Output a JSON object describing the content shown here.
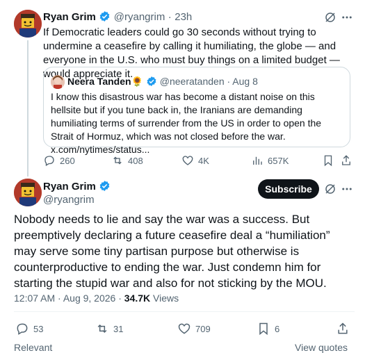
{
  "tweet1": {
    "author_name": "Ryan Grim",
    "handle": "@ryangrim",
    "time": "23h",
    "text": "If Democratic leaders could go 30 seconds without trying to undermine a ceasefire by calling it humiliating, the globe — and everyone in the U.S. who must buy things on a limited budget — would appreciate it.",
    "quote": {
      "author_name": "Neera Tanden",
      "emoji": "🌻",
      "handle": "@neeratanden",
      "date": "Aug 8",
      "text": "I know this disastrous war has become a distant noise on this hellsite but if you tune back in, the Iranians are demanding humiliating terms of surrender from the US in order to open the Strait of Hormuz, which was not closed before the war. x.com/nytimes/status..."
    },
    "stats": {
      "replies": "260",
      "reposts": "408",
      "likes": "4K",
      "views": "657K"
    }
  },
  "tweet2": {
    "author_name": "Ryan Grim",
    "handle": "@ryangrim",
    "subscribe_label": "Subscribe",
    "text": "Nobody needs to lie and say the war was a success. But preemptively declaring a future ceasefire deal a “humiliation” may serve some tiny partisan purpose but otherwise is counterproductive to ending the war. Just condemn him for starting the stupid war and also for not sticking by the MOU.",
    "timestamp": "12:07 AM · Aug 9, 2026 · ",
    "views_count": "34.7K",
    "views_label": " Views",
    "stats": {
      "replies": "53",
      "reposts": "31",
      "likes": "709",
      "bookmarks": "6"
    }
  },
  "footer": {
    "relevant": "Relevant",
    "view_quotes": "View quotes"
  },
  "colors": {
    "verified": "#1d9bf0",
    "muted": "#536471",
    "text": "#0f1419",
    "border": "#cfd9de"
  }
}
